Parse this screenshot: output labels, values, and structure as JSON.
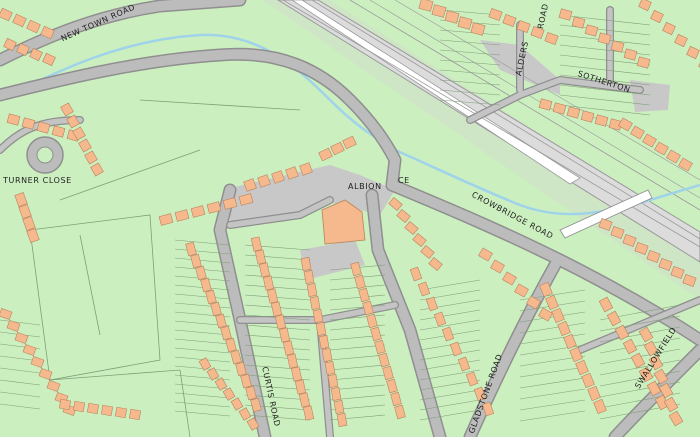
{
  "map": {
    "colors": {
      "land": "#ccefc0",
      "road": "#b9b9b9",
      "road_outline": "#8f8f8f",
      "building": "#f5b98d",
      "building_outline": "#b9835e",
      "parcel_line": "#7f9f76",
      "water": "#a8d9ef",
      "rail": "#d9d9d9",
      "rail_track": "#ffffff"
    },
    "labels": {
      "new_town_road": "NEW TOWN ROAD",
      "turner_close": "TURNER CLOSE",
      "albion": "ALBION",
      "albion_suffix": "CE",
      "crowbridge_road": "CROWBRIDGE ROAD",
      "curtis_road": "CURTIS ROAD",
      "gladstone_road": "GLADSTONE ROAD",
      "swallowfield": "SWALLOWFIELD",
      "southerton": "SOTHERTON",
      "alders_road": "ALDERS",
      "road_fragment": "ROAD"
    }
  }
}
